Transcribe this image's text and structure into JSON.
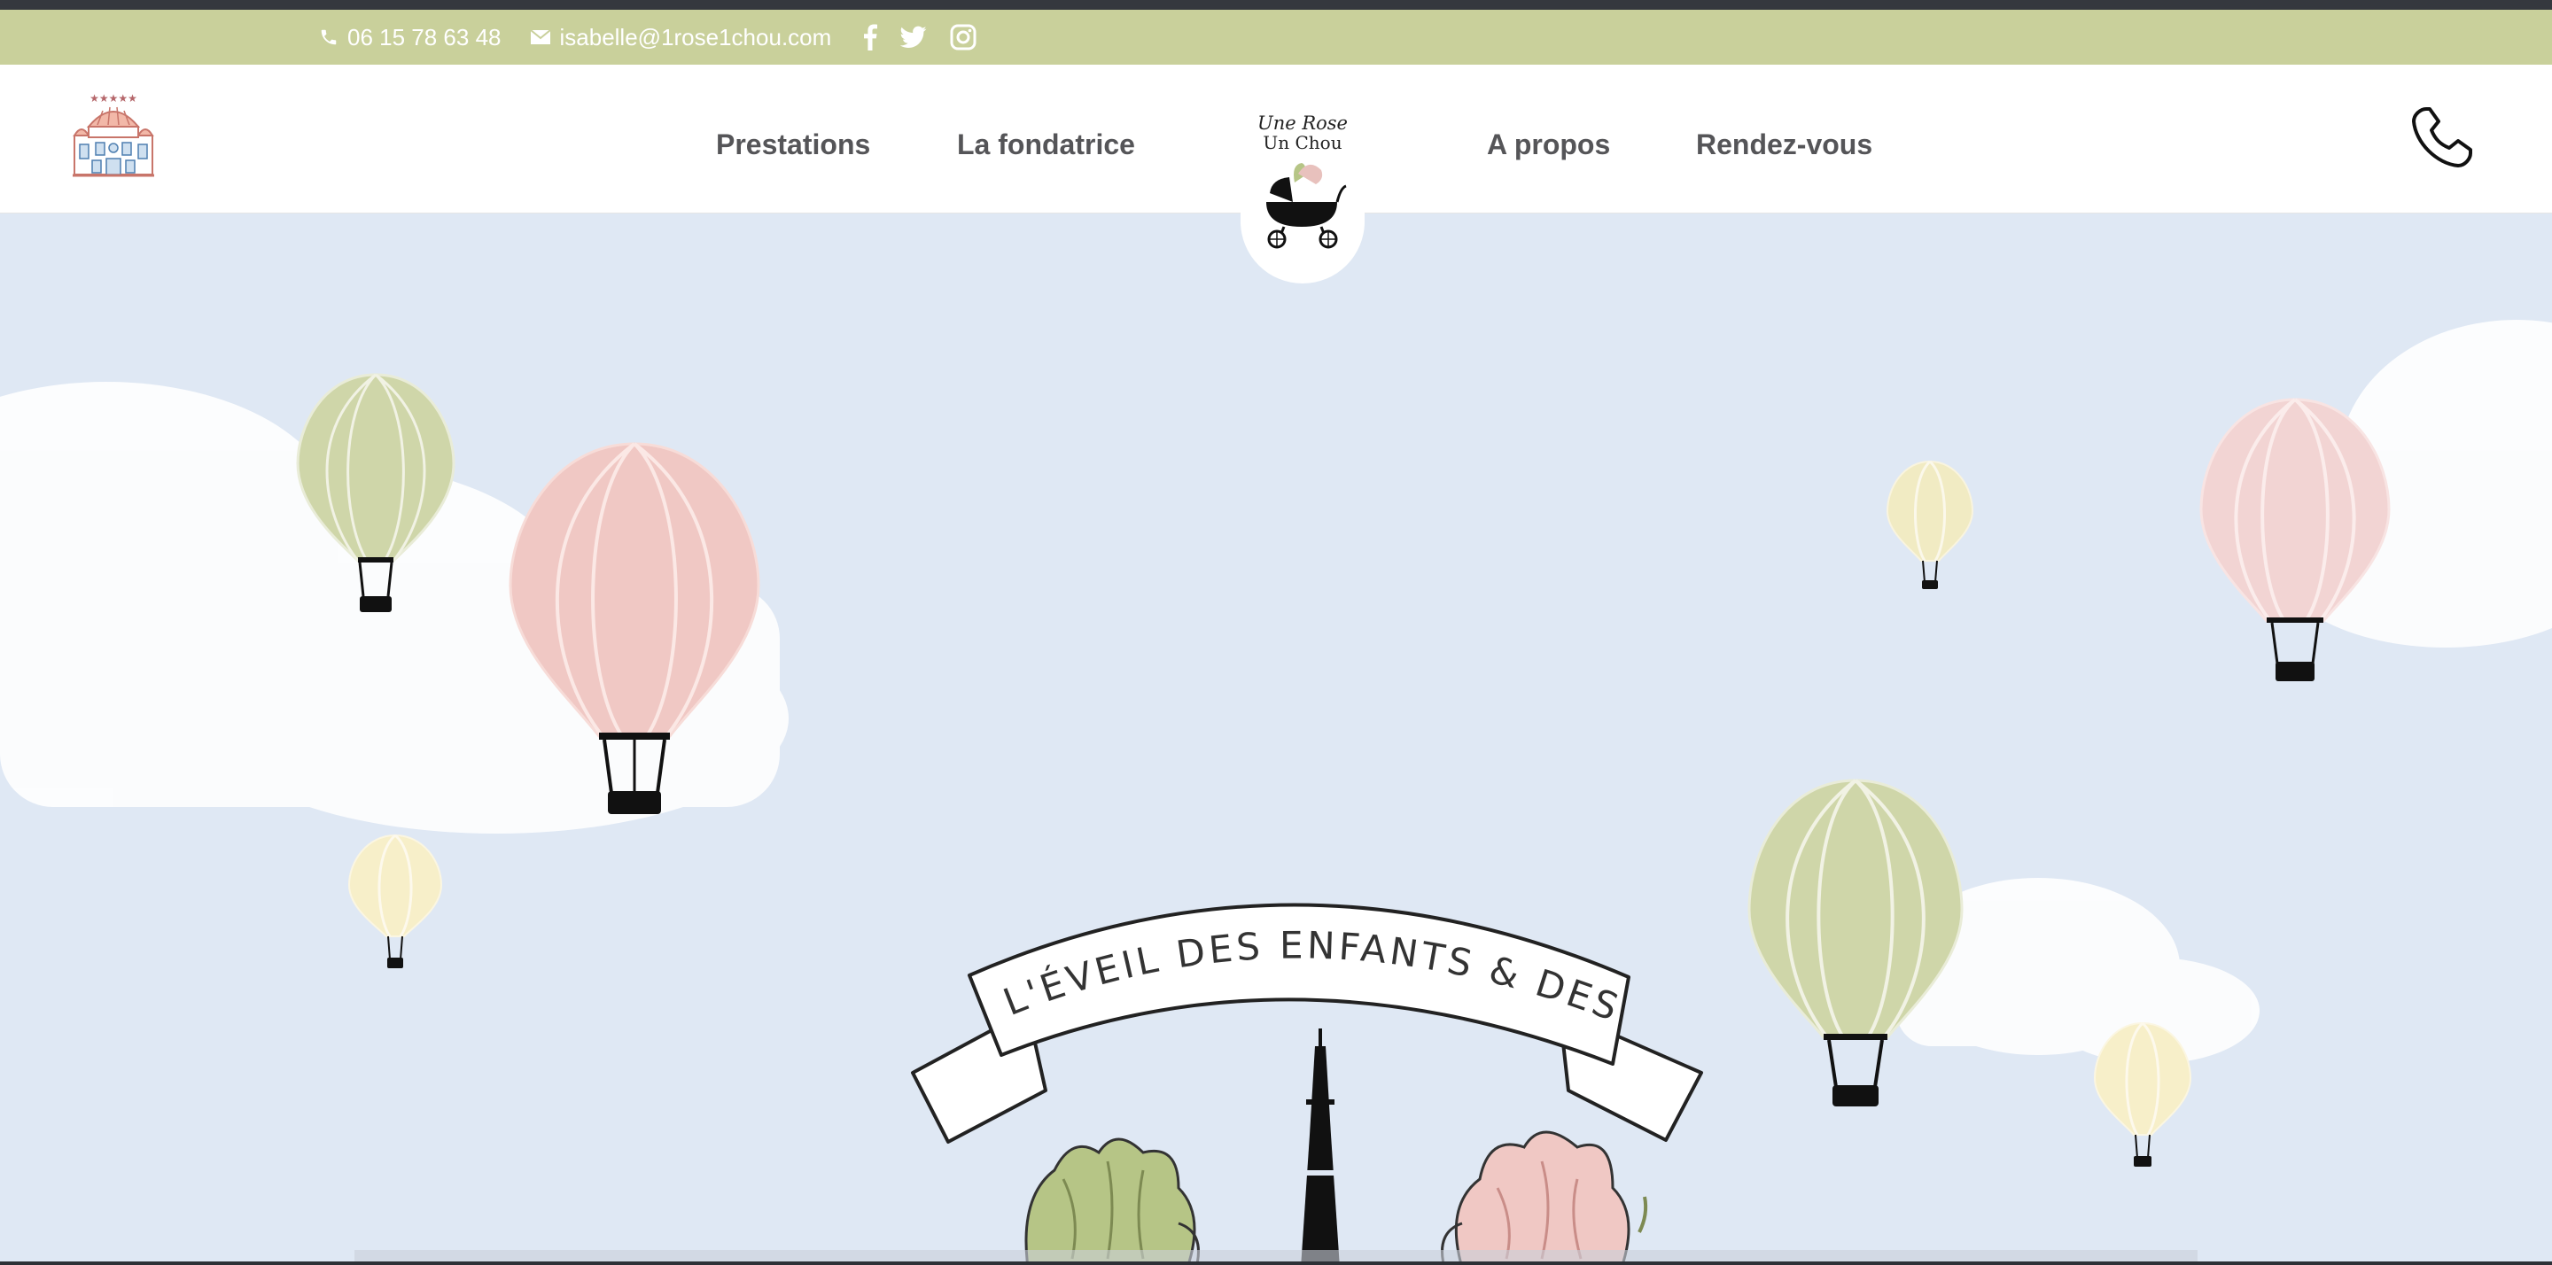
{
  "topbar": {
    "phone": "06 15 78 63 48",
    "email": "isabelle@1rose1chou.com",
    "social_icons": [
      "facebook-icon",
      "twitter-icon",
      "instagram-icon"
    ]
  },
  "nav": {
    "items": [
      {
        "label": "Prestations"
      },
      {
        "label": "La fondatrice"
      },
      {
        "label": "A propos"
      },
      {
        "label": "Rendez-vous"
      }
    ]
  },
  "brand": {
    "line1": "Une Rose",
    "line2": "Un Chou"
  },
  "hero": {
    "banner_text": "CULTIVER L'ÉVEIL DES ENFANTS & DES PARENTS"
  },
  "colors": {
    "top_bar": "#c9d09b",
    "sky": "#dfe8f4",
    "balloon_green": "#cfd6a9",
    "balloon_pink": "#f0c8c4",
    "balloon_yellow": "#f7efc9",
    "nav_text": "#555558"
  }
}
